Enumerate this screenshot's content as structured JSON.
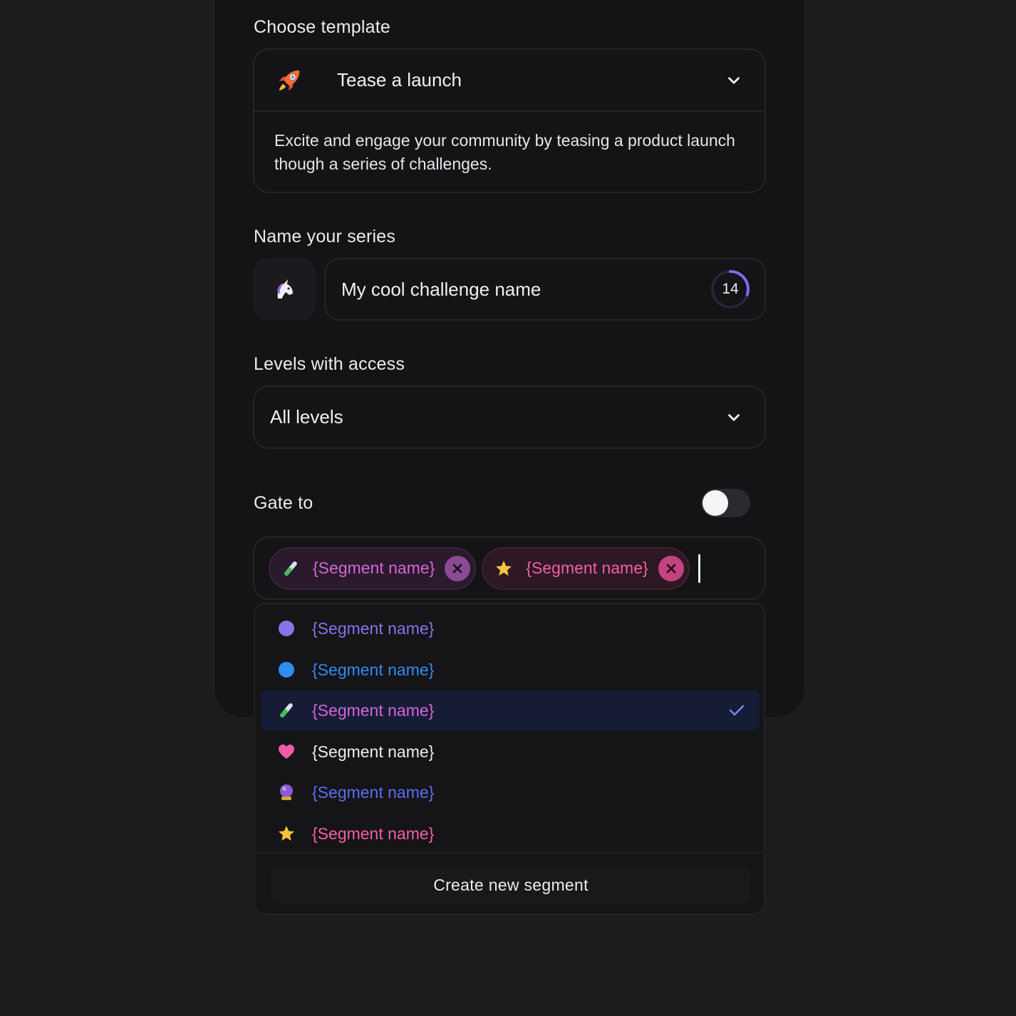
{
  "template": {
    "label": "Choose template",
    "selected": "Tease a launch",
    "icon": "rocket-icon",
    "description": "Excite and engage your community by teasing a product launch though a series of challenges."
  },
  "series": {
    "label": "Name your series",
    "emoji_icon": "unicorn-icon",
    "name_value": "My cool challenge name",
    "char_count": "14",
    "progress_fraction": 0.3
  },
  "levels": {
    "label": "Levels with access",
    "selected": "All levels"
  },
  "gate": {
    "label": "Gate to",
    "toggle_on": false,
    "chips": [
      {
        "icon": "test-tube-icon",
        "text": "{Segment name}",
        "color": "#d565d8"
      },
      {
        "icon": "star-icon",
        "text": "{Segment name}",
        "color": "#f25fa6"
      }
    ]
  },
  "dropdown": {
    "options": [
      {
        "icon": "purple-dot-icon",
        "color": "#8a72e8",
        "text": "{Segment name}",
        "selected": false
      },
      {
        "icon": "blue-dot-icon",
        "color": "#2f8cf0",
        "text": "{Segment name}",
        "selected": false
      },
      {
        "icon": "test-tube-icon",
        "color": "#d565d8",
        "text": "{Segment name}",
        "selected": true
      },
      {
        "icon": "heart-icon",
        "color": "#ececef",
        "text": "{Segment name}",
        "selected": false
      },
      {
        "icon": "crystal-ball-icon",
        "color": "#5a6ff0",
        "text": "{Segment name}",
        "selected": false
      },
      {
        "icon": "star-icon",
        "color": "#f25fa6",
        "text": "{Segment name}",
        "selected": false
      }
    ],
    "create_label": "Create new segment"
  }
}
